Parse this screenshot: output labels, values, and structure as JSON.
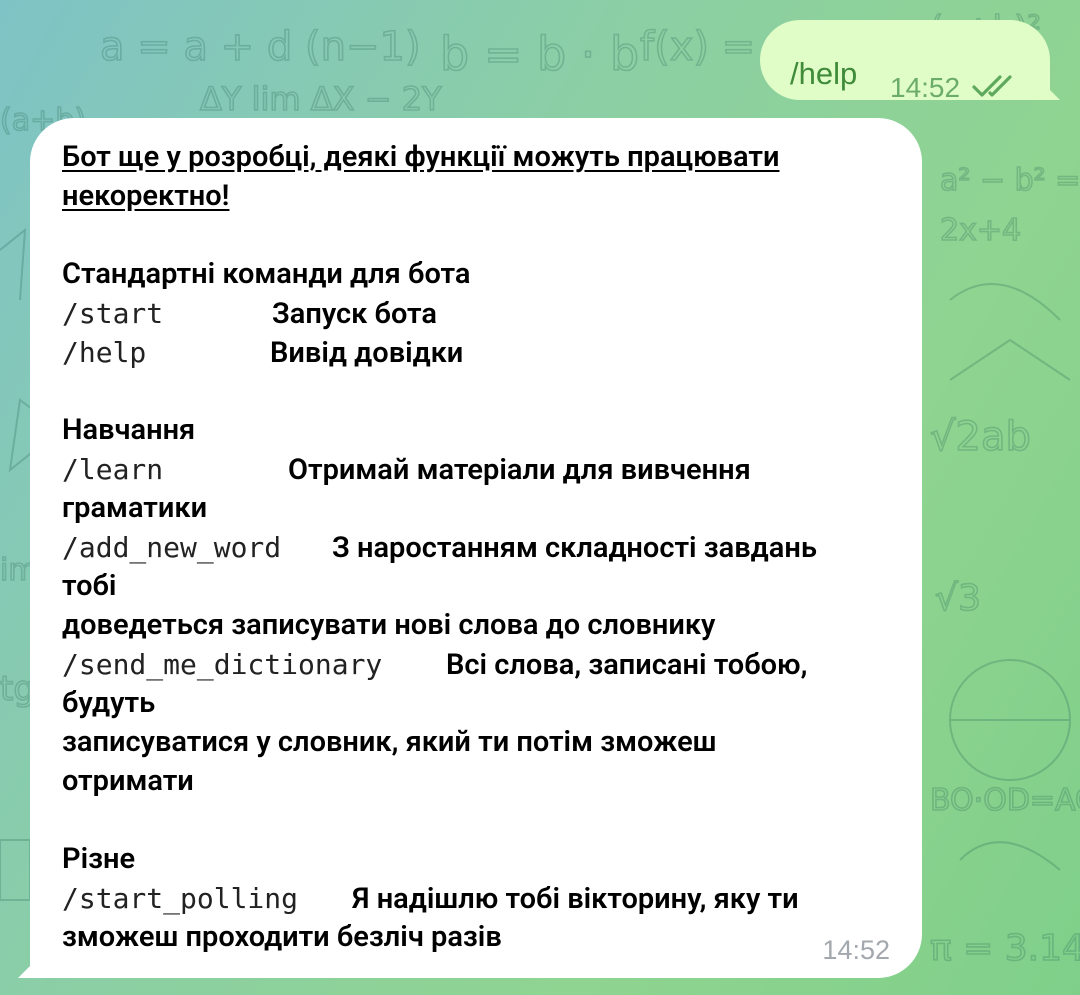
{
  "chat": {
    "outgoing": {
      "text": "/help",
      "time": "14:52",
      "status_icon": "double-check-icon"
    },
    "incoming": {
      "warning_line1": "Бот ще у розробці, деякі функції можуть працювати",
      "warning_line2": "некоректно!",
      "section_standard": "Стандартні команди для бота",
      "cmd_start": "/start",
      "desc_start": "Запуск бота",
      "cmd_help": "/help",
      "desc_help": "Вивід довідки",
      "section_learning": "Навчання",
      "cmd_learn": "/learn",
      "desc_learn_1": "Отримай матеріали для вивчення",
      "desc_learn_2": "граматики",
      "cmd_add_new_word": "/add_new_word",
      "desc_add_1": "З наростанням складності завдань",
      "desc_add_2": "тобі",
      "desc_add_3": "доведеться записувати нові слова до словнику",
      "cmd_send_me_dictionary": "/send_me_dictionary",
      "desc_dict_1": "Всі слова, записані тобою,",
      "desc_dict_2": "будуть",
      "desc_dict_3": "записуватися у словник, який ти потім зможеш",
      "desc_dict_4": "отримати",
      "section_misc": "Різне",
      "cmd_start_polling": "/start_polling",
      "desc_poll_1": "Я надішлю тобі вікторину, яку ти",
      "desc_poll_2": "зможеш проходити безліч разів",
      "time": "14:52"
    }
  },
  "theme": {
    "outgoing_bubble": "#e0fdc7",
    "outgoing_text": "#3f8b3a",
    "incoming_bubble": "#ffffff",
    "background_gradient": [
      "#7fc3c6",
      "#8fd490"
    ]
  }
}
